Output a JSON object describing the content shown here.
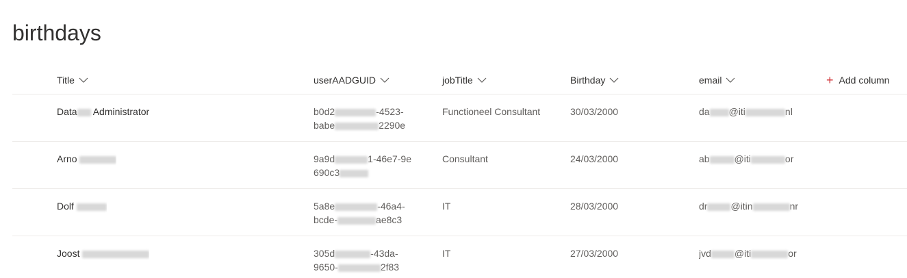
{
  "list": {
    "title": "birthdays"
  },
  "columns": {
    "title": "Title",
    "guid": "userAADGUID",
    "job": "jobTitle",
    "birthday": "Birthday",
    "email": "email",
    "add_column": "Add column"
  },
  "rows": [
    {
      "title_a": "Data",
      "title_b": "Administrator",
      "guid_l1_a": "b0d2",
      "guid_l1_b": "-4523-",
      "guid_l2_a": "babe",
      "guid_l2_b": "2290e",
      "job": "Functioneel Consultant",
      "birthday": "30/03/2000",
      "email_a": "da",
      "email_b": "@iti",
      "email_c": "nl"
    },
    {
      "title_a": "Arno",
      "title_b": "",
      "guid_l1_a": "9a9d",
      "guid_l1_b": "1-46e7-9e",
      "guid_l2_a": "690c3",
      "guid_l2_b": "",
      "job": "Consultant",
      "birthday": "24/03/2000",
      "email_a": "ab",
      "email_b": "@iti",
      "email_c": "or"
    },
    {
      "title_a": "Dolf",
      "title_b": "",
      "guid_l1_a": "5a8e",
      "guid_l1_b": "-46a4-",
      "guid_l2_a": "bcde-",
      "guid_l2_b": "ae8c3",
      "job": "IT",
      "birthday": "28/03/2000",
      "email_a": "dr",
      "email_b": "@itin",
      "email_c": "nr"
    },
    {
      "title_a": "Joost",
      "title_b": "",
      "guid_l1_a": "305d",
      "guid_l1_b": "-43da-",
      "guid_l2_a": "9650-",
      "guid_l2_b": "2f83",
      "job": "IT",
      "birthday": "27/03/2000",
      "email_a": "jvd",
      "email_b": "@iti",
      "email_c": "or"
    }
  ],
  "colors": {
    "accent_plus": "#d13438",
    "border": "#edebe9",
    "text": "#323130",
    "muted": "#605e5c"
  },
  "icons": [
    "chevron-down-icon",
    "plus-icon"
  ]
}
